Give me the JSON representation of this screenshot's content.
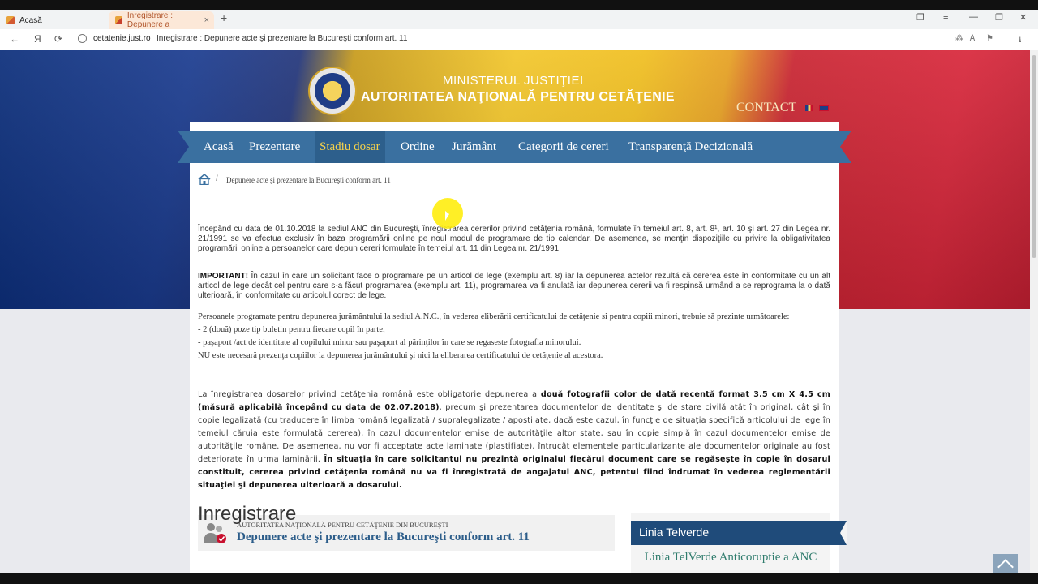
{
  "browser": {
    "tabs": [
      {
        "label": "Acasă"
      },
      {
        "label": "Inregistrare : Depunere a"
      }
    ],
    "new_tab_symbol": "+",
    "close_symbol": "×",
    "url_domain": "cetatenie.just.ro",
    "url_title": "Inregistrare : Depunere acte şi prezentare la Bucureşti conform art. 11",
    "nav": {
      "back": "←",
      "yandex": "Я",
      "reload": "⟳"
    },
    "window": {
      "collections": "❐",
      "menu": "≡",
      "minimize": "—",
      "maximize": "❐",
      "close": "✕"
    },
    "right_icons": {
      "translate": "⁂",
      "reader": "Ꭺ",
      "bookmark": "⚑",
      "download": "⭳"
    }
  },
  "header": {
    "ministry": "MINISTERUL JUSTIŢIEI",
    "authority": "AUTORITATEA NAŢIONALĂ PENTRU CETĂŢENIE",
    "contact": "CONTACT",
    "flag_colors": [
      "#0a2d7a",
      "#f2c62a",
      "#c92431"
    ]
  },
  "nav": {
    "items": [
      "Acasă",
      "Prezentare",
      "Stadiu dosar",
      "Ordine",
      "Jurământ",
      "Categorii de cereri",
      "Transparenţă Decizională"
    ],
    "active": "Stadiu dosar"
  },
  "breadcrumb": {
    "current": "Depunere acte şi prezentare la Bucureşti conform art. 11"
  },
  "content": {
    "p1": " Începând cu data de 01.10.2018 la sediul ANC din Bucureşti, înregistrarea cererilor privind cetăţenia română, formulate în temeiul art. 8, art. 8¹, art. 10 şi art. 27 din Legea nr. 21/1991 se va efectua exclusiv în baza programării online pe noul modul de programare de tip calendar. De asemenea, se menţin dispoziţiile cu privire la obligativitatea programării online a persoanelor care depun cereri formulate în temeiul art. 11 din Legea nr. 21/1991.",
    "important_label": "IMPORTANT!",
    "important_text": " În cazul în care un solicitant face o programare pe un articol de lege (exemplu art. 8) iar la depunerea actelor rezultă că cererea este în conformitate cu un alt articol de lege decât cel pentru care s-a făcut programarea (exemplu art. 11), programarea va fi anulată iar depunerea cererii va fi respinsă urmând a se reprograma la o dată ulterioară, în conformitate cu articolul corect de lege.",
    "oath_intro": "   Persoanele programate pentru depunerea jurământului la sediul A.N.C., în vederea eliberării certificatului de cetăţenie si pentru copiii minori, trebuie să prezinte următoarele:",
    "oath_items": [
      "   - 2 (două) poze tip buletin pentru fiecare copil în parte;",
      "   - paşaport /act de identitate al copilului minor sau paşaport al părinţilor în care se regaseste fotografia minorului."
    ],
    "oath_note": "  NU este necesară prezenţa copiilor la depunerea jurământului şi nici la eliberarea certificatului de cetăţenie al acestora.",
    "photos_a": "      La înregistrarea dosarelor privind cetăţenia română este obligatorie depunerea a ",
    "photos_b": "două fotografii color de dată recentă format 3.5 cm X 4.5 cm (măsură aplicabilă începând cu data de 02.07.2018)",
    "photos_c": ", precum şi prezentarea documentelor de identitate şi de stare civilă atât în original, cât şi în copie legalizată (cu traducere în limba română legalizată / supralegalizate / apostilate, dacă este cazul, în funcţie de situaţia specifică articolului de lege în temeiul căruia este formulată cererea), în cazul documentelor emise de autorităţile altor state, sau în copie simplă în cazul documentelor emise de autorităţile române. De asemenea, nu vor fi acceptate acte laminate (plastifiate), întrucât elementele particularizante ale documentelor originale au fost deteriorate în urma laminării. ",
    "photos_d": "În situaţia în care solicitantul nu prezintă originalul fiecărui document care se regăseşte în copie în dosarul constituit, cererea privind cetăţenia română nu va fi înregistrată de angajatul ANC, petentul fiind îndrumat în vederea reglementării situaţiei şi depunerea ulterioară a dosarului."
  },
  "card": {
    "eyebrow": "AUTORITATEA NAŢIONALĂ PENTRU CETĂŢENIE DIN BUCUREŞTI",
    "title": "Depunere acte şi prezentare la Bucureşti conform art. 11",
    "heading": "Inregistrare"
  },
  "sidebar": {
    "title": "Linia Telverde",
    "link": "Linia TelVerde Anticoruptie a ANC"
  }
}
